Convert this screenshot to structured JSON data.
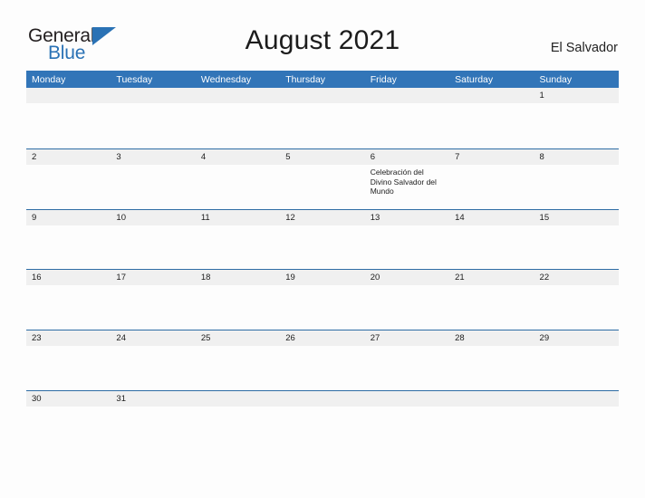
{
  "brand": {
    "word_one": "General",
    "word_two": "Blue",
    "triangle_icon": "triangle-icon",
    "color_dark": "#231f20",
    "color_blue": "#2a72b5"
  },
  "header": {
    "title": "August 2021",
    "country": "El Salvador"
  },
  "theme": {
    "header_blue": "#3275b8",
    "row_rule_blue": "#2e6ca4",
    "number_band_gray": "#f0f0f0",
    "page_background": "#fdfdfd",
    "text_dark": "#1c1c1c"
  },
  "calendar": {
    "day_headers": [
      "Monday",
      "Tuesday",
      "Wednesday",
      "Thursday",
      "Friday",
      "Saturday",
      "Sunday"
    ],
    "weeks": [
      {
        "days": [
          {
            "number": "",
            "event": ""
          },
          {
            "number": "",
            "event": ""
          },
          {
            "number": "",
            "event": ""
          },
          {
            "number": "",
            "event": ""
          },
          {
            "number": "",
            "event": ""
          },
          {
            "number": "",
            "event": ""
          },
          {
            "number": "1",
            "event": ""
          }
        ]
      },
      {
        "days": [
          {
            "number": "2",
            "event": ""
          },
          {
            "number": "3",
            "event": ""
          },
          {
            "number": "4",
            "event": ""
          },
          {
            "number": "5",
            "event": ""
          },
          {
            "number": "6",
            "event": "Celebración del Divino Salvador del Mundo"
          },
          {
            "number": "7",
            "event": ""
          },
          {
            "number": "8",
            "event": ""
          }
        ]
      },
      {
        "days": [
          {
            "number": "9",
            "event": ""
          },
          {
            "number": "10",
            "event": ""
          },
          {
            "number": "11",
            "event": ""
          },
          {
            "number": "12",
            "event": ""
          },
          {
            "number": "13",
            "event": ""
          },
          {
            "number": "14",
            "event": ""
          },
          {
            "number": "15",
            "event": ""
          }
        ]
      },
      {
        "days": [
          {
            "number": "16",
            "event": ""
          },
          {
            "number": "17",
            "event": ""
          },
          {
            "number": "18",
            "event": ""
          },
          {
            "number": "19",
            "event": ""
          },
          {
            "number": "20",
            "event": ""
          },
          {
            "number": "21",
            "event": ""
          },
          {
            "number": "22",
            "event": ""
          }
        ]
      },
      {
        "days": [
          {
            "number": "23",
            "event": ""
          },
          {
            "number": "24",
            "event": ""
          },
          {
            "number": "25",
            "event": ""
          },
          {
            "number": "26",
            "event": ""
          },
          {
            "number": "27",
            "event": ""
          },
          {
            "number": "28",
            "event": ""
          },
          {
            "number": "29",
            "event": ""
          }
        ]
      },
      {
        "days": [
          {
            "number": "30",
            "event": ""
          },
          {
            "number": "31",
            "event": ""
          },
          {
            "number": "",
            "event": ""
          },
          {
            "number": "",
            "event": ""
          },
          {
            "number": "",
            "event": ""
          },
          {
            "number": "",
            "event": ""
          },
          {
            "number": "",
            "event": ""
          }
        ]
      }
    ]
  }
}
